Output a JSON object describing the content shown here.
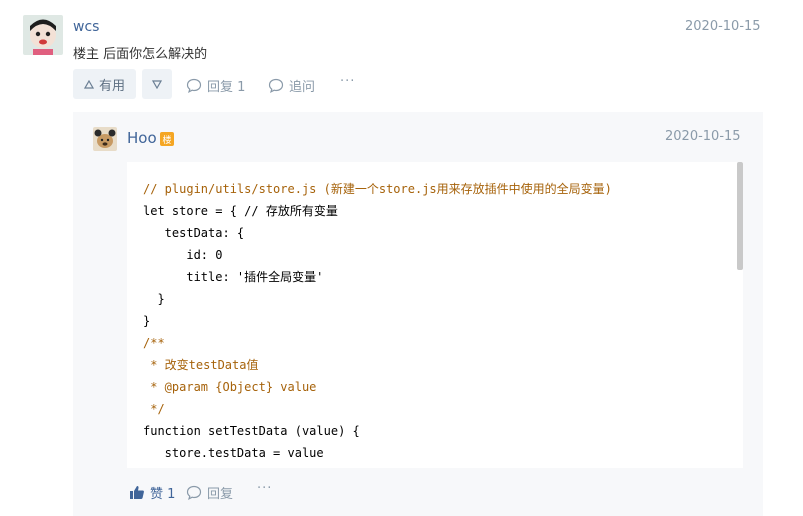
{
  "comment": {
    "username": "wcs",
    "date": "2020-10-15",
    "text": "楼主 后面你怎么解决的",
    "actions": {
      "like_label": "有用",
      "reply_label": "回复 1",
      "ask_label": "追问",
      "more_label": "···"
    }
  },
  "reply": {
    "username": "Hoo",
    "badge": "楼",
    "date": "2020-10-15",
    "code_lines": [
      "// plugin/utils/store.js (新建一个store.js用来存放插件中使用的全局变量)",
      "let store = { // 存放所有变量",
      "   testData: {",
      "      id: 0",
      "      title: '插件全局变量'",
      "  }",
      "}",
      "/**",
      " * 改变testData值",
      " * @param {Object} value",
      " */",
      "function setTestData (value) {",
      "   store.testData = value",
      "}"
    ],
    "actions": {
      "like_label": "赞 1",
      "reply_label": "回复",
      "more_label": "···"
    }
  },
  "colors": {
    "username": "#406599",
    "meta": "#8a9aa9",
    "badge": "#f5a623",
    "panel": "#f7f8fa"
  }
}
